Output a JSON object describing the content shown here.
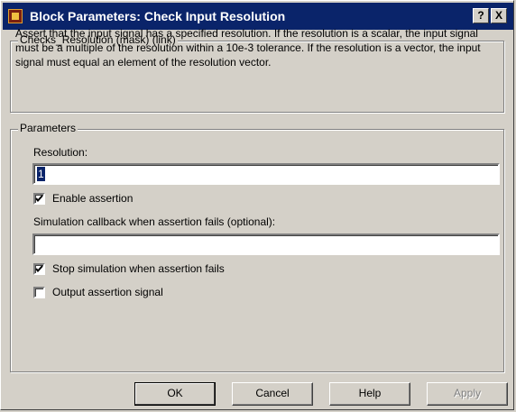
{
  "window": {
    "title": "Block Parameters: Check Input  Resolution",
    "help_button": "?",
    "close_button": "X"
  },
  "mask_group": {
    "legend": "Checks_Resolution (mask) (link)",
    "description": "Assert that the input signal has a specified resolution.  If the resolution is a scalar, the input signal must be a multiple of the resolution within a 10e-3 tolerance.  If the resolution is a vector, the input signal must equal an element of the resolution vector."
  },
  "parameters": {
    "legend": "Parameters",
    "resolution_label": "Resolution:",
    "resolution_value": "1",
    "enable_assertion_label": "Enable assertion",
    "enable_assertion_checked": true,
    "callback_label": "Simulation callback when assertion fails (optional):",
    "callback_value": "",
    "stop_sim_label": "Stop simulation when assertion fails",
    "stop_sim_checked": true,
    "output_signal_label": "Output assertion signal",
    "output_signal_checked": false
  },
  "buttons": {
    "ok": "OK",
    "cancel": "Cancel",
    "help": "Help",
    "apply": "Apply"
  }
}
